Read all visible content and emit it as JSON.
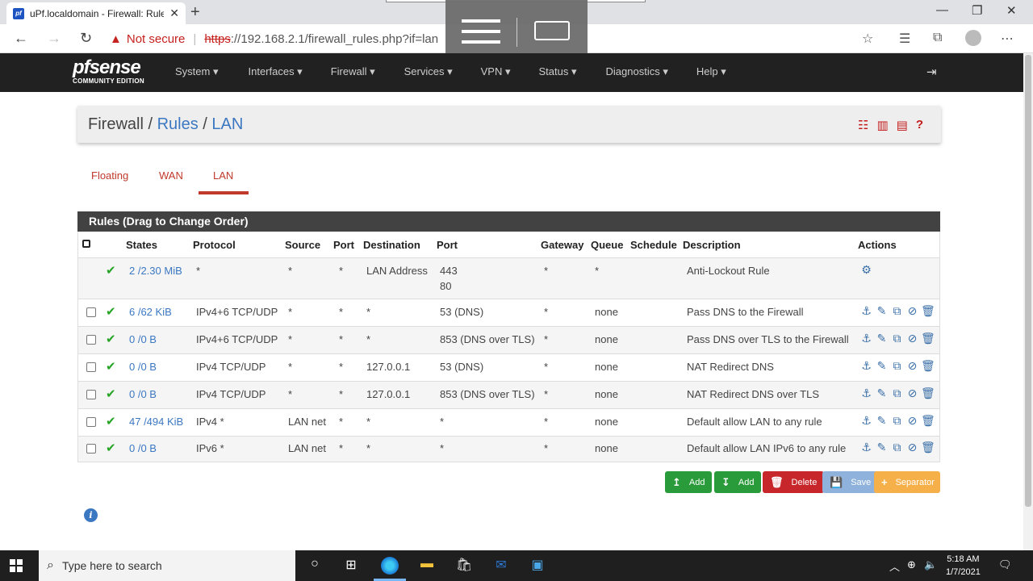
{
  "browser": {
    "tab_title": "uPf.localdomain - Firewall: Rules:",
    "favicon_label": "pf",
    "not_secure": "Not secure",
    "url_scheme": "https",
    "url_rest": "://192.168.2.1/firewall_rules.php?if=lan"
  },
  "brand": {
    "logo_main": "pfsense",
    "logo_sub": "COMMUNITY EDITION"
  },
  "nav": {
    "items": [
      "System ▾",
      "Interfaces ▾",
      "Firewall ▾",
      "Services ▾",
      "VPN ▾",
      "Status ▾",
      "Diagnostics ▾",
      "Help ▾"
    ]
  },
  "breadcrumb": {
    "root": "Firewall",
    "sep1": " / ",
    "mid": "Rules",
    "sep2": " / ",
    "leaf": "LAN"
  },
  "tabs": [
    "Floating",
    "WAN",
    "LAN"
  ],
  "panel_title": "Rules (Drag to Change Order)",
  "columns": [
    "States",
    "Protocol",
    "Source",
    "Port",
    "Destination",
    "Port",
    "Gateway",
    "Queue",
    "Schedule",
    "Description",
    "Actions"
  ],
  "rows": [
    {
      "states": "2 /2.30 MiB",
      "protocol": "*",
      "source": "*",
      "sport": "*",
      "dest": "LAN Address",
      "dport": "443",
      "dport2": "80",
      "gateway": "*",
      "queue": "*",
      "schedule": "",
      "desc": "Anti-Lockout Rule"
    },
    {
      "states": "6 /62 KiB",
      "protocol": "IPv4+6 TCP/UDP",
      "source": "*",
      "sport": "*",
      "dest": "*",
      "dport": "53 (DNS)",
      "gateway": "*",
      "queue": "none",
      "schedule": "",
      "desc": "Pass DNS to the Firewall"
    },
    {
      "states": "0 /0 B",
      "protocol": "IPv4+6 TCP/UDP",
      "source": "*",
      "sport": "*",
      "dest": "*",
      "dport": "853 (DNS over TLS)",
      "gateway": "*",
      "queue": "none",
      "schedule": "",
      "desc": "Pass DNS over TLS to the Firewall"
    },
    {
      "states": "0 /0 B",
      "protocol": "IPv4 TCP/UDP",
      "source": "*",
      "sport": "*",
      "dest": "127.0.0.1",
      "dport": "53 (DNS)",
      "gateway": "*",
      "queue": "none",
      "schedule": "",
      "desc": "NAT Redirect DNS"
    },
    {
      "states": "0 /0 B",
      "protocol": "IPv4 TCP/UDP",
      "source": "*",
      "sport": "*",
      "dest": "127.0.0.1",
      "dport": "853 (DNS over TLS)",
      "gateway": "*",
      "queue": "none",
      "schedule": "",
      "desc": "NAT Redirect DNS over TLS"
    },
    {
      "states": "47 /494 KiB",
      "protocol": "IPv4 *",
      "source": "LAN net",
      "sport": "*",
      "dest": "*",
      "dport": "*",
      "gateway": "*",
      "queue": "none",
      "schedule": "",
      "desc": "Default allow LAN to any rule"
    },
    {
      "states": "0 /0 B",
      "protocol": "IPv6 *",
      "source": "LAN net",
      "sport": "*",
      "dest": "*",
      "dport": "*",
      "gateway": "*",
      "queue": "none",
      "schedule": "",
      "desc": "Default allow LAN IPv6 to any rule"
    }
  ],
  "buttons": {
    "add_top": "Add",
    "add_bottom": "Add",
    "delete": "Delete",
    "save": "Save",
    "separator": "Separator"
  },
  "taskbar": {
    "search_placeholder": "Type here to search",
    "time": "5:18 AM",
    "date": "1/7/2021"
  },
  "colors": {
    "nav_bg": "#212121",
    "link": "#3c78c2",
    "accent_red": "#c0392b",
    "success": "#25a425",
    "btn_add": "#2a9b3a",
    "btn_delete": "#c7262b",
    "btn_save": "#8fb2dc",
    "btn_separator": "#f6b04a"
  }
}
